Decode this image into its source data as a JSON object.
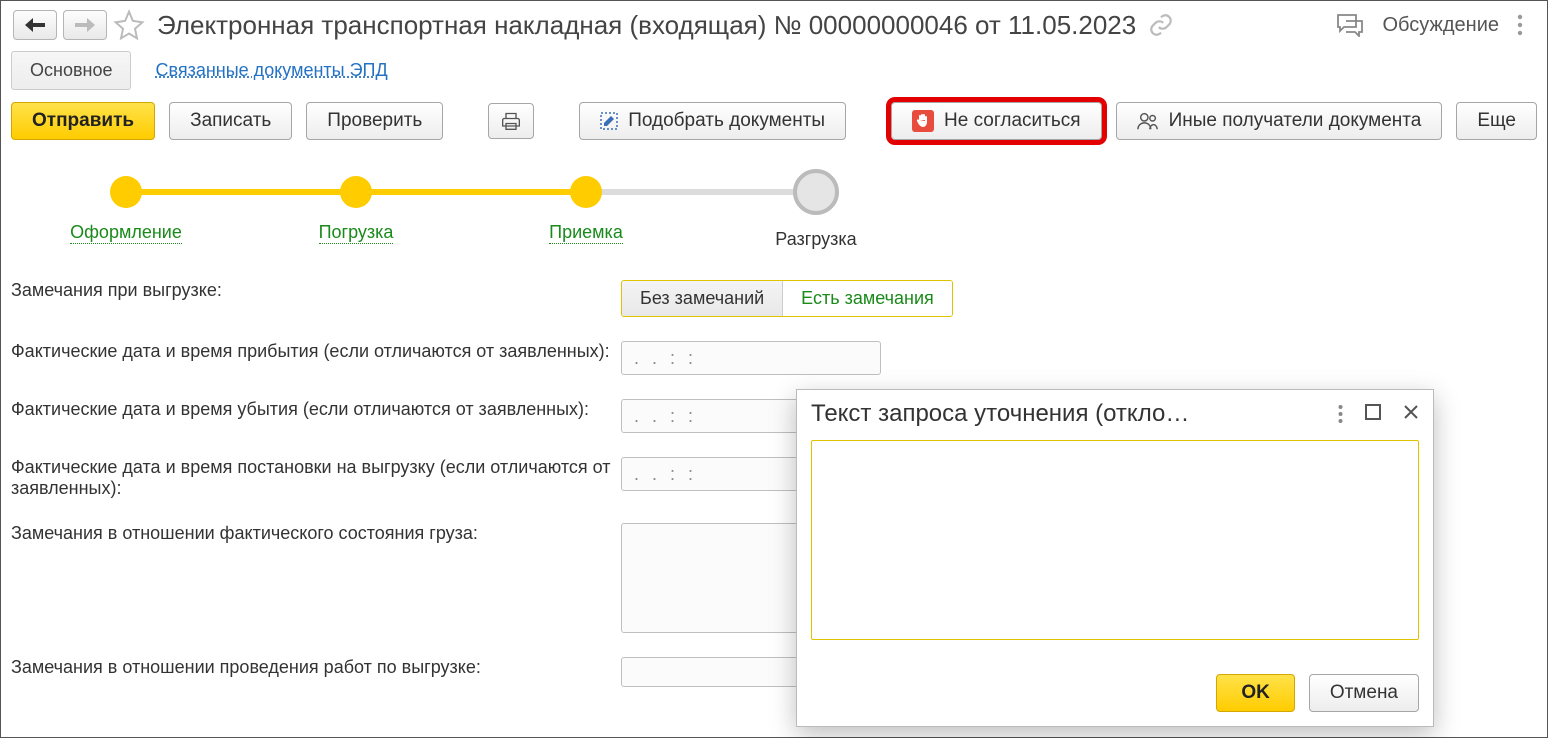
{
  "header": {
    "title": "Электронная транспортная накладная (входящая) № 00000000046 от 11.05.2023",
    "discuss": "Обсуждение"
  },
  "nav": {
    "main": "Основное",
    "related": "Связанные документы ЭПД"
  },
  "toolbar": {
    "send": "Отправить",
    "save": "Записать",
    "check": "Проверить",
    "select_docs": "Подобрать документы",
    "disagree": "Не согласиться",
    "other_recipients": "Иные получатели документа",
    "more": "Еще"
  },
  "process": {
    "steps": [
      {
        "label": "Оформление",
        "state": "done"
      },
      {
        "label": "Погрузка",
        "state": "done"
      },
      {
        "label": "Приемка",
        "state": "done"
      },
      {
        "label": "Разгрузка",
        "state": "current"
      }
    ]
  },
  "form": {
    "remarks_unload": "Замечания при выгрузке:",
    "seg_no": "Без замечаний",
    "seg_yes": "Есть замечания",
    "arrival": "Фактические дата и время прибытия (если отличаются от заявленных):",
    "departure": "Фактические дата и время убытия (если отличаются от заявленных):",
    "positioning": "Фактические дата и время постановки на выгрузку (если отличаются от заявленных):",
    "cargo_state": "Замечания в отношении фактического состояния груза:",
    "work_state": "Замечания в отношении проведения работ по выгрузке:",
    "dt_placeholder": ". .    : :"
  },
  "dialog": {
    "title": "Текст запроса уточнения (откло…",
    "ok": "OK",
    "cancel": "Отмена"
  }
}
